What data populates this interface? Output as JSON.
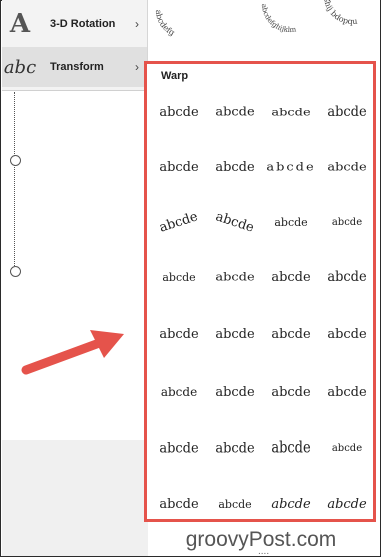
{
  "menu": {
    "rotation": {
      "label": "3-D Rotation",
      "icon": "3d-rotation-letter-icon",
      "glyph": "A"
    },
    "transform": {
      "label": "Transform",
      "icon": "transform-abc-icon",
      "glyph": "abc"
    },
    "chevron": "›"
  },
  "top_strip": {
    "ring1": "abcdefg",
    "ring2": "abcdefghijklm",
    "ring3": "Ghij bdopqu"
  },
  "warp": {
    "title": "Warp",
    "sample_text": "abcde",
    "rows": [
      [
        "abcde",
        "abcde",
        "abcde",
        "abcde"
      ],
      [
        "abcde",
        "abcde",
        "abcde",
        "abcde"
      ],
      [
        "abcde",
        "abcde",
        "abcde",
        "abcde"
      ],
      [
        "abcde",
        "abcde",
        "abcde",
        "abcde"
      ],
      [
        "abcde",
        "abcde",
        "abcde",
        "abcde"
      ],
      [
        "abcde",
        "abcde",
        "abcde",
        "abcde"
      ],
      [
        "abcde",
        "abcde",
        "abcde",
        "abcde"
      ],
      [
        "abcde",
        "abcde",
        "abcde",
        "abcde"
      ]
    ]
  },
  "watermark": "groovyPost.com",
  "more_indicator": "....",
  "colors": {
    "highlight": "#e5534b",
    "arrow": "#e5534b",
    "menu_bg": "#f3f3f3",
    "menu_selected": "#e0e0e0"
  }
}
